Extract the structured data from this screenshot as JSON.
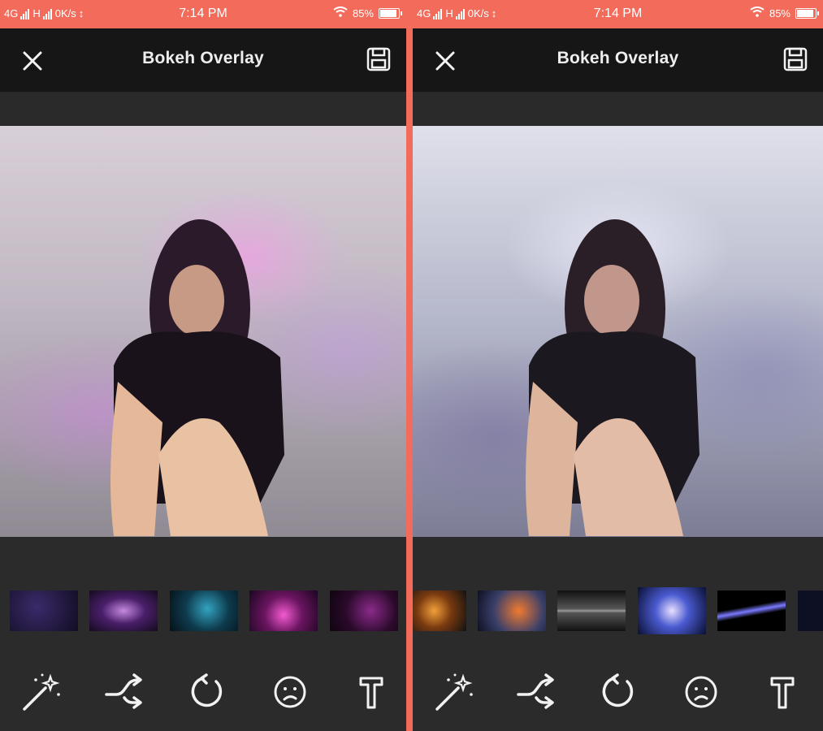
{
  "colors": {
    "status_bar": "#f36b5a",
    "app_bar": "#161616",
    "background": "#2b2b2b",
    "icon": "#f2f2f2"
  },
  "status_bar": {
    "network_1": "4G",
    "network_2": "H",
    "speed": "0K/s",
    "time": "7:14 PM",
    "battery": "85%"
  },
  "screens": [
    {
      "title": "Bokeh Overlay",
      "close_icon": "close-icon",
      "save_icon": "save-icon",
      "overlay_thumbnails": [
        "dark-blue-nebula",
        "purple-galaxy",
        "teal-nebula",
        "magenta-nebula",
        "violet-nebula"
      ]
    },
    {
      "title": "Bokeh Overlay",
      "close_icon": "close-icon",
      "save_icon": "save-icon",
      "overlay_thumbnails": [
        "orange-nebula",
        "red-orange-nebula",
        "star-streak",
        "blue-galaxy",
        "blue-lightning",
        "partial-thumbnail"
      ]
    }
  ],
  "toolbar": [
    "magic-wand-icon",
    "shuffle-icon",
    "rotate-icon",
    "sad-face-icon",
    "text-icon"
  ]
}
